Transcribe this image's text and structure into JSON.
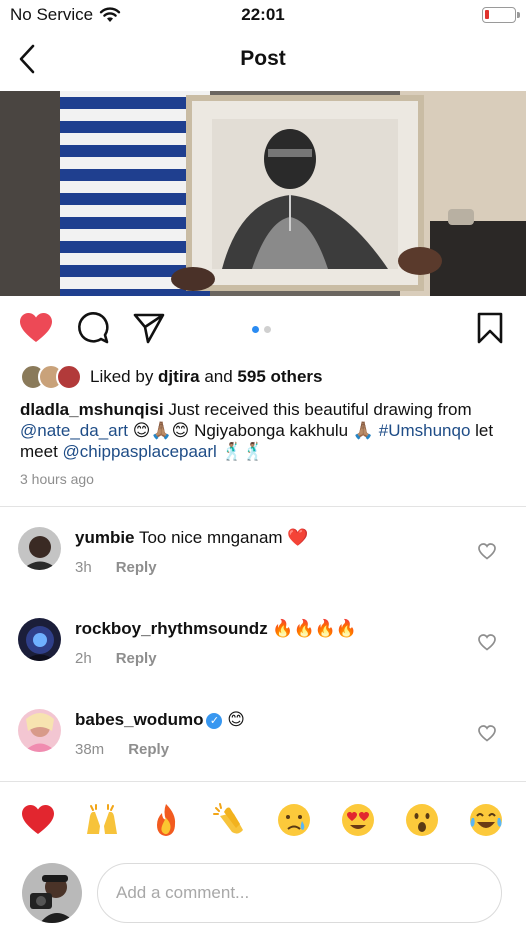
{
  "status_bar": {
    "carrier": "No Service",
    "time": "22:01",
    "battery_level": 0.05
  },
  "nav": {
    "title": "Post",
    "back_icon": "chevron-left-icon"
  },
  "post": {
    "image_page": 1,
    "image_count": 2,
    "actions": {
      "like_icon": "heart-filled-icon",
      "comment_icon": "comment-bubble-icon",
      "share_icon": "paper-plane-icon",
      "save_icon": "bookmark-icon"
    },
    "likes": {
      "prefix": "Liked by ",
      "user": "djtira",
      "middle": " and ",
      "others": "595 others"
    },
    "caption": {
      "user": "dladla_mshunqisi",
      "text_1": " Just received this beautiful drawing from ",
      "mention_1": "@nate_da_art",
      "text_2": " 😊🙏🏽😊 Ngiyabonga kakhulu 🙏🏽 ",
      "hashtag": "#Umshunqo",
      "text_3": " let meet ",
      "mention_2": "@chippasplacepaarl",
      "text_4": " 🕺🏽🕺🏽"
    },
    "timestamp": "3 hours ago"
  },
  "comments": [
    {
      "user": "yumbie",
      "text": " Too nice mnganam ❤️",
      "time": "3h",
      "reply": "Reply",
      "verified": false
    },
    {
      "user": "rockboy_rhythmsoundz",
      "text": " 🔥🔥🔥🔥",
      "time": "2h",
      "reply": "Reply",
      "verified": false
    },
    {
      "user": "babes_wodumo",
      "text": " 😊",
      "time": "38m",
      "reply": "Reply",
      "verified": true
    }
  ],
  "quick_reactions": [
    "❤️",
    "🙌",
    "🔥",
    "👏",
    "😢",
    "😍",
    "😮",
    "😂"
  ],
  "comment_input": {
    "placeholder": "Add a comment..."
  },
  "colors": {
    "like_red": "#ed4956",
    "link_blue": "#1f4d87",
    "verified_blue": "#3897f0",
    "carousel_active": "#2a8bf2",
    "muted_gray": "#8e8e8e"
  }
}
